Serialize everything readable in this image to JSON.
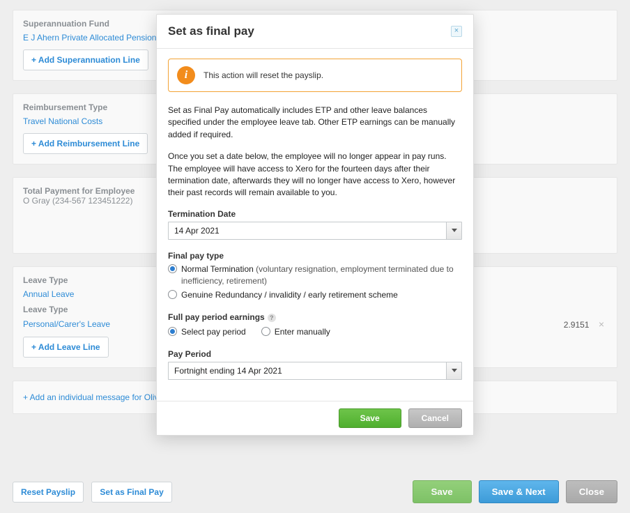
{
  "super_panel": {
    "label": "Superannuation Fund",
    "item": "E J Ahern Private Allocated Pension Fund",
    "add_button": "+ Add Superannuation Line"
  },
  "reimb_panel": {
    "label": "Reimbursement Type",
    "item": "Travel National Costs",
    "add_button": "+ Add Reimbursement Line"
  },
  "total_panel": {
    "line1": "Total Payment for Employee",
    "line2": "O Gray (234-567 123451222)"
  },
  "leave_panel": {
    "label": "Leave Type",
    "item1": "Annual Leave",
    "label2": "Leave Type",
    "item2": "Personal/Carer's Leave",
    "value2": "2.9151",
    "add_button": "+ Add Leave Line"
  },
  "msg_panel": {
    "link": "+ Add an individual message for Oliver"
  },
  "footer": {
    "reset": "Reset Payslip",
    "final": "Set as Final Pay",
    "save": "Save",
    "save_next": "Save & Next",
    "close": "Close"
  },
  "modal": {
    "title": "Set as final pay",
    "alert": "This action will reset the payslip.",
    "para1": "Set as Final Pay automatically includes ETP and other leave balances specified under the employee leave tab. Other ETP earnings can be manually added if required.",
    "para2": "Once you set a date below, the employee will no longer appear in pay runs. The employee will have access to Xero for the fourteen days after their termination date, afterwards they will no longer have access to Xero, however their past records will remain available to you.",
    "term_date_label": "Termination Date",
    "term_date_value": "14 Apr 2021",
    "final_type_label": "Final pay type",
    "radio_normal": "Normal Termination ",
    "radio_normal_sub": "(voluntary resignation, employment terminated due to inefficiency, retirement)",
    "radio_redundancy": "Genuine Redundancy / invalidity / early retirement scheme",
    "full_pay_label": "Full pay period earnings",
    "radio_select_period": "Select pay period",
    "radio_enter_manual": "Enter manually",
    "pay_period_label": "Pay Period",
    "pay_period_value": "Fortnight ending 14 Apr 2021",
    "save": "Save",
    "cancel": "Cancel"
  }
}
